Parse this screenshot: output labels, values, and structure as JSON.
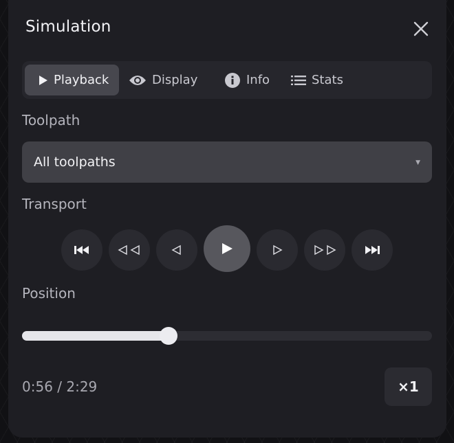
{
  "panel": {
    "title": "Simulation"
  },
  "tabs": [
    {
      "label": "Playback",
      "icon": "play-icon",
      "active": true
    },
    {
      "label": "Display",
      "icon": "eye-icon",
      "active": false
    },
    {
      "label": "Info",
      "icon": "info-icon",
      "active": false
    },
    {
      "label": "Stats",
      "icon": "list-icon",
      "active": false
    }
  ],
  "toolpath": {
    "label": "Toolpath",
    "selected": "All toolpaths"
  },
  "transport": {
    "label": "Transport",
    "buttons": [
      "skip-to-start",
      "fast-rewind",
      "step-back",
      "play",
      "step-forward",
      "fast-forward",
      "skip-to-end"
    ]
  },
  "position": {
    "label": "Position",
    "progress": 0.358,
    "time": "0:56 / 2:29"
  },
  "speed": {
    "label": "×1"
  },
  "colors": {
    "panel": "#1e1e23",
    "active_tab": "#47474e",
    "slider_fill": "#e6e6ea"
  }
}
